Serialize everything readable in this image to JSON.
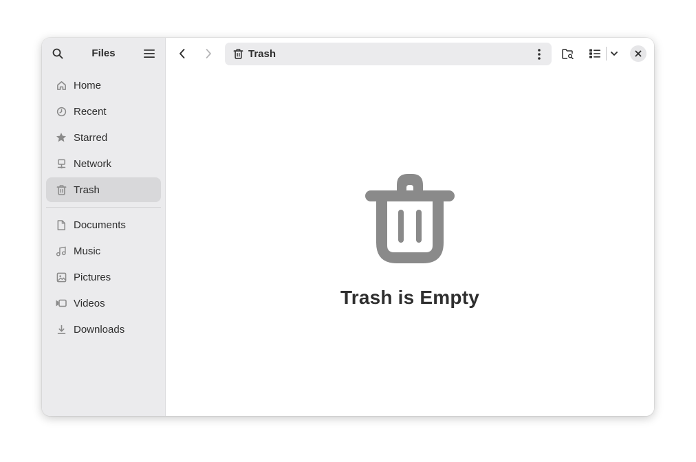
{
  "window": {
    "app_title": "Files"
  },
  "sidebar": {
    "places": [
      {
        "label": "Home",
        "icon": "home-icon"
      },
      {
        "label": "Recent",
        "icon": "clock-icon"
      },
      {
        "label": "Starred",
        "icon": "star-icon"
      },
      {
        "label": "Network",
        "icon": "network-icon"
      },
      {
        "label": "Trash",
        "icon": "trash-icon",
        "active": true
      }
    ],
    "bookmarks": [
      {
        "label": "Documents",
        "icon": "document-icon"
      },
      {
        "label": "Music",
        "icon": "music-icon"
      },
      {
        "label": "Pictures",
        "icon": "picture-icon"
      },
      {
        "label": "Videos",
        "icon": "video-icon"
      },
      {
        "label": "Downloads",
        "icon": "download-icon"
      }
    ]
  },
  "pathbar": {
    "current": "Trash",
    "icon": "trash-icon"
  },
  "empty_state": {
    "title": "Trash is Empty",
    "icon": "trash-icon"
  },
  "colors": {
    "sidebar_bg": "#ebebed",
    "active_item": "#d8d8da",
    "icon": "#8a8a8a",
    "text": "#2e2e2e"
  }
}
